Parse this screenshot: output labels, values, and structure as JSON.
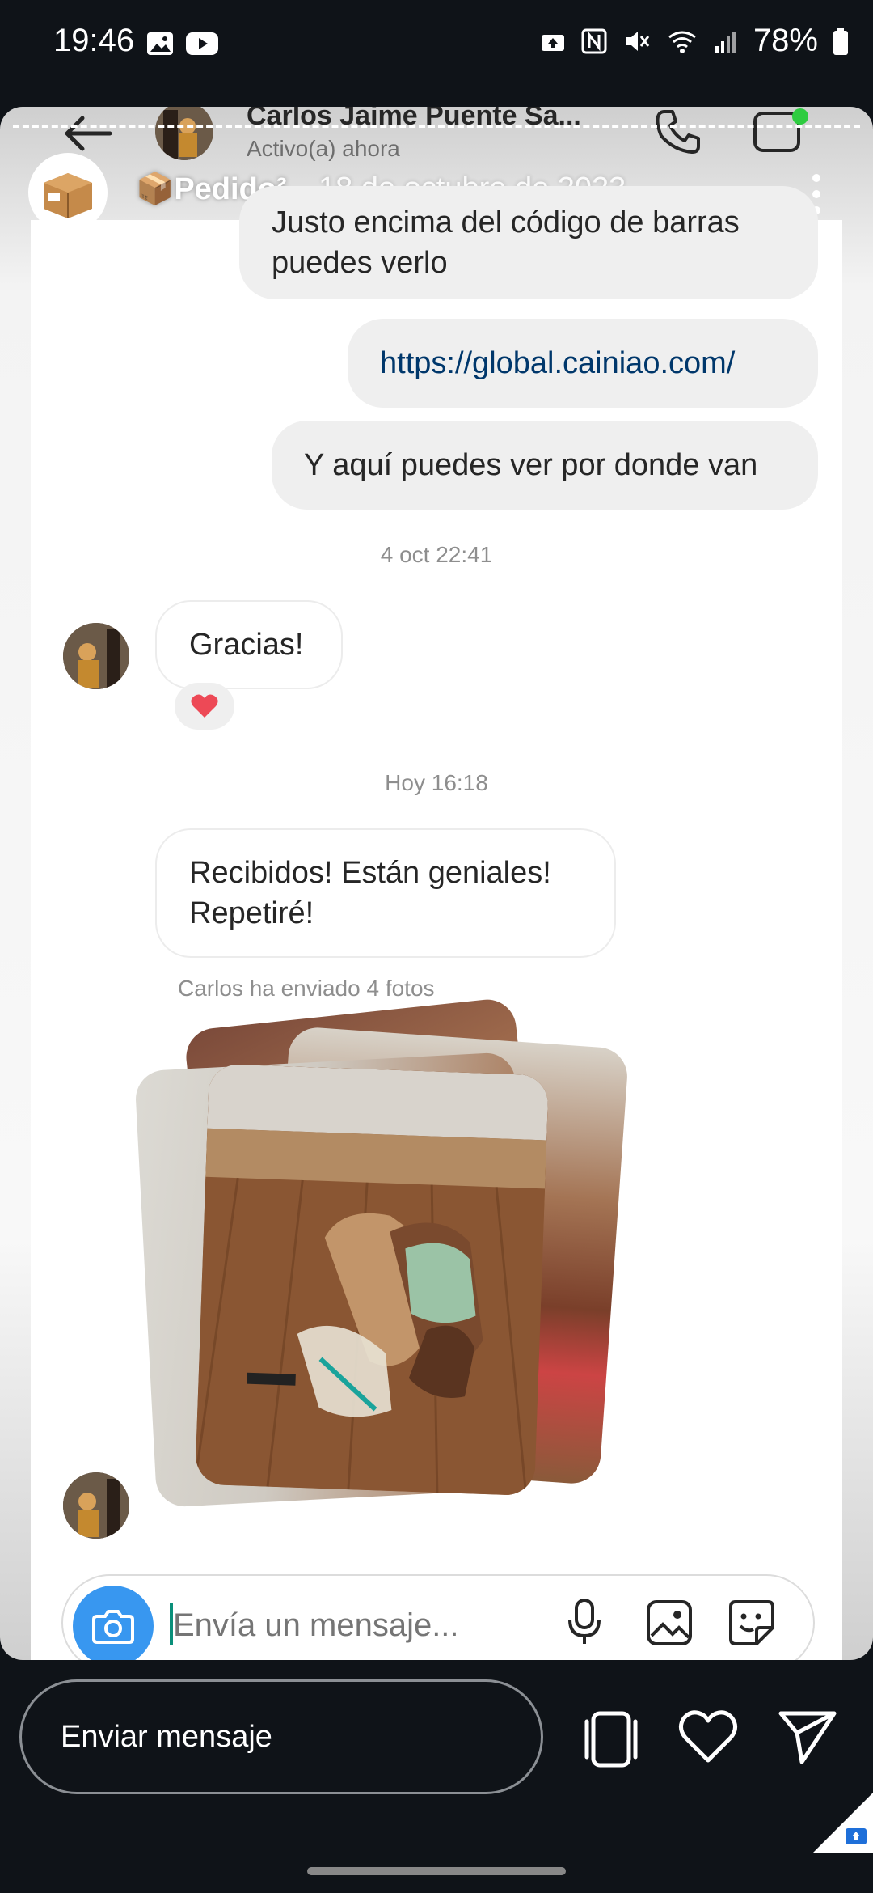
{
  "status_bar": {
    "time": "19:46",
    "battery": "78%"
  },
  "story": {
    "owner_name": "📦Pedido²",
    "date": "18 de octubre de 2023"
  },
  "chat": {
    "contact_name": "Carlos Jaime Puente Sa...",
    "contact_status": "Activo(a) ahora",
    "messages": [
      {
        "text_line1": "Justo encima del código de barras",
        "text_line2": "puedes verlo"
      },
      {
        "link": "https://global.cainiao.com/"
      },
      {
        "text": "Y aquí puedes ver por donde van"
      }
    ],
    "timestamp1": "4 oct 22:41",
    "incoming1": "Gracias!",
    "reaction": "❤️",
    "timestamp2": "Hoy 16:18",
    "incoming2_line1": "Recibidos! Están geniales!",
    "incoming2_line2": "Repetiré!",
    "photos_caption": "Carlos ha enviado 4 fotos",
    "composer_placeholder": "Envía un mensaje..."
  },
  "story_footer": {
    "reply_placeholder": "Enviar mensaje"
  },
  "colors": {
    "accent_blue": "#3897f0",
    "link": "#00376b",
    "online_dot": "#2ecc40"
  }
}
